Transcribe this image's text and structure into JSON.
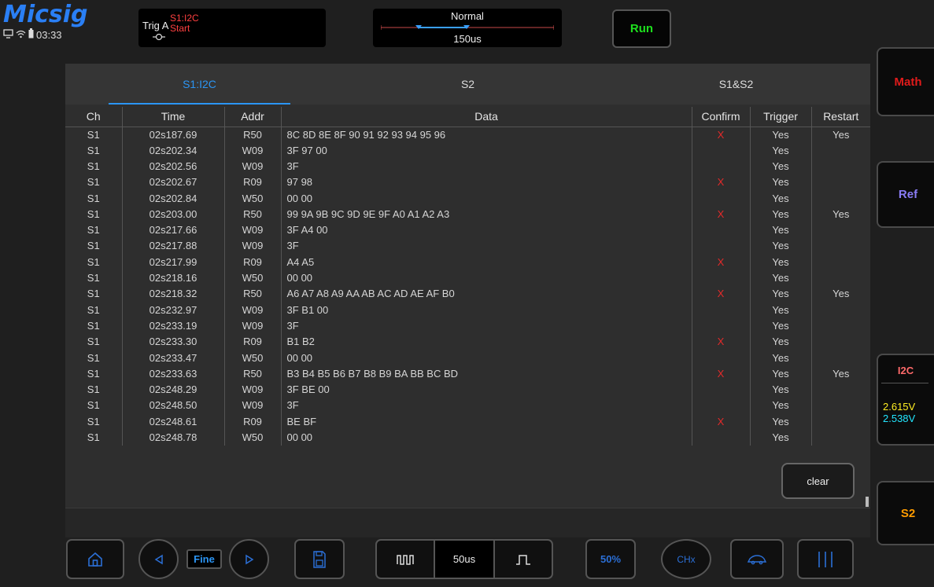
{
  "header": {
    "brand": "Micsig",
    "time": "03:33",
    "icons": [
      "monitor-icon",
      "wifi-icon",
      "battery-icon"
    ],
    "trigger": {
      "label": "Trig  A",
      "source_line1": "S1:I2C",
      "source_line2": "Start"
    },
    "timebase": {
      "mode": "Normal",
      "value": "150us"
    },
    "run_label": "Run"
  },
  "side": {
    "math": "Math",
    "ref": "Ref",
    "i2c_title": "I2C",
    "i2c_level1": "2.615V",
    "i2c_level2": "2.538V",
    "s2": "S2"
  },
  "tabs": [
    {
      "label": "S1:I2C",
      "active": true
    },
    {
      "label": "S2",
      "active": false
    },
    {
      "label": "S1&S2",
      "active": false
    }
  ],
  "table": {
    "columns": [
      "Ch",
      "Time",
      "Addr",
      "Data",
      "Confirm",
      "Trigger",
      "Restart"
    ],
    "rows": [
      [
        "S1",
        "02s187.69",
        "R50",
        "8C 8D 8E 8F 90 91 92 93 94 95 96",
        "X",
        "Yes",
        "Yes"
      ],
      [
        "S1",
        "02s202.34",
        "W09",
        "3F 97 00",
        "",
        "Yes",
        ""
      ],
      [
        "S1",
        "02s202.56",
        "W09",
        "3F",
        "",
        "Yes",
        ""
      ],
      [
        "S1",
        "02s202.67",
        "R09",
        "97 98",
        "X",
        "Yes",
        ""
      ],
      [
        "S1",
        "02s202.84",
        "W50",
        "00 00",
        "",
        "Yes",
        ""
      ],
      [
        "S1",
        "02s203.00",
        "R50",
        "99 9A 9B 9C 9D 9E 9F A0 A1 A2 A3",
        "X",
        "Yes",
        "Yes"
      ],
      [
        "S1",
        "02s217.66",
        "W09",
        "3F A4 00",
        "",
        "Yes",
        ""
      ],
      [
        "S1",
        "02s217.88",
        "W09",
        "3F",
        "",
        "Yes",
        ""
      ],
      [
        "S1",
        "02s217.99",
        "R09",
        "A4 A5",
        "X",
        "Yes",
        ""
      ],
      [
        "S1",
        "02s218.16",
        "W50",
        "00 00",
        "",
        "Yes",
        ""
      ],
      [
        "S1",
        "02s218.32",
        "R50",
        "A6 A7 A8 A9 AA AB AC AD AE AF B0",
        "X",
        "Yes",
        "Yes"
      ],
      [
        "S1",
        "02s232.97",
        "W09",
        "3F B1 00",
        "",
        "Yes",
        ""
      ],
      [
        "S1",
        "02s233.19",
        "W09",
        "3F",
        "",
        "Yes",
        ""
      ],
      [
        "S1",
        "02s233.30",
        "R09",
        "B1 B2",
        "X",
        "Yes",
        ""
      ],
      [
        "S1",
        "02s233.47",
        "W50",
        "00 00",
        "",
        "Yes",
        ""
      ],
      [
        "S1",
        "02s233.63",
        "R50",
        "B3 B4 B5 B6 B7 B8 B9 BA BB BC BD",
        "X",
        "Yes",
        "Yes"
      ],
      [
        "S1",
        "02s248.29",
        "W09",
        "3F BE 00",
        "",
        "Yes",
        ""
      ],
      [
        "S1",
        "02s248.50",
        "W09",
        "3F",
        "",
        "Yes",
        ""
      ],
      [
        "S1",
        "02s248.61",
        "R09",
        "BE BF",
        "X",
        "Yes",
        ""
      ],
      [
        "S1",
        "02s248.78",
        "W50",
        "00 00",
        "",
        "Yes",
        ""
      ]
    ]
  },
  "clear_label": "clear",
  "toolbar": {
    "fine_label": "Fine",
    "timebase_value": "50us",
    "fifty_label": "50%",
    "chx_label": "CHx"
  },
  "colors": {
    "accent": "#2b95f4",
    "run": "#1de01d",
    "math": "#e01b1b",
    "ref": "#8a7cf5",
    "s2": "#ff9c00",
    "confirm_x": "#e32a2a"
  }
}
